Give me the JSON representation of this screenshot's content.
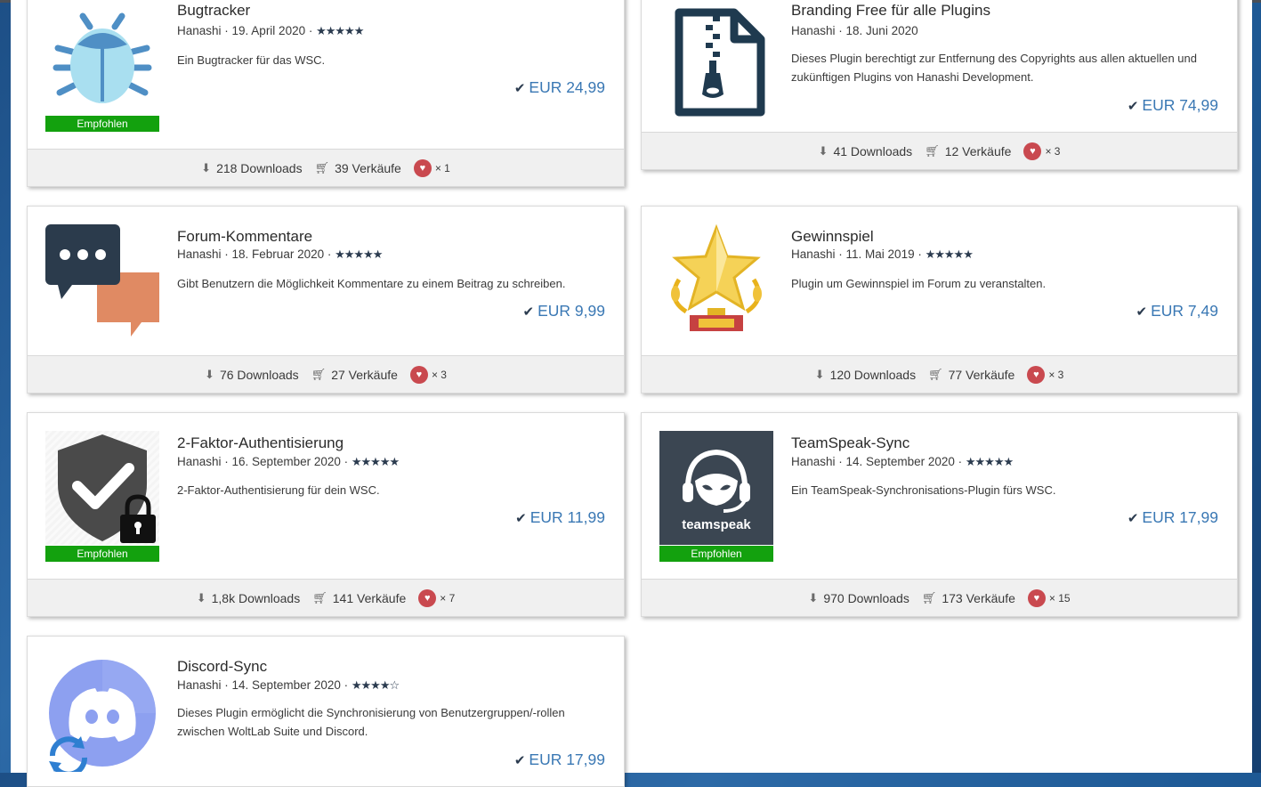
{
  "cards": [
    {
      "title": "Bugtracker",
      "author": "Hanashi",
      "date": "19. April 2020",
      "stars": "★★★★★",
      "description": "Ein Bugtracker für das WSC.",
      "price": "EUR 24,99",
      "badge": "Empfohlen",
      "downloads": "218 Downloads",
      "sales": "39 Verkäufe",
      "likes": "× 1",
      "icon": "bug-icon"
    },
    {
      "title": "Branding Free für alle Plugins",
      "author": "Hanashi",
      "date": "18. Juni 2020",
      "stars": "",
      "description": "Dieses Plugin berechtigt zur Entfernung des Copyrights aus allen aktuellen und zukünftigen Plugins von Hanashi Development.",
      "price": "EUR 74,99",
      "badge": "",
      "downloads": "41 Downloads",
      "sales": "12 Verkäufe",
      "likes": "× 3",
      "icon": "zip-file-icon"
    },
    {
      "title": "Forum-Kommentare",
      "author": "Hanashi",
      "date": "18. Februar 2020",
      "stars": "★★★★★",
      "description": "Gibt Benutzern die Möglichkeit Kommentare zu einem Beitrag zu schreiben.",
      "price": "EUR 9,99",
      "badge": "",
      "downloads": "76 Downloads",
      "sales": "27 Verkäufe",
      "likes": "× 3",
      "icon": "chat-bubbles-icon"
    },
    {
      "title": "Gewinnspiel",
      "author": "Hanashi",
      "date": "11. Mai 2019",
      "stars": "★★★★★",
      "description": "Plugin um Gewinnspiel im Forum zu veranstalten.",
      "price": "EUR 7,49",
      "badge": "",
      "downloads": "120 Downloads",
      "sales": "77 Verkäufe",
      "likes": "× 3",
      "icon": "star-trophy-icon"
    },
    {
      "title": "2-Faktor-Authentisierung",
      "author": "Hanashi",
      "date": "16. September 2020",
      "stars": "★★★★★",
      "description": "2-Faktor-Authentisierung für dein WSC.",
      "price": "EUR 11,99",
      "badge": "Empfohlen",
      "downloads": "1,8k Downloads",
      "sales": "141 Verkäufe",
      "likes": "× 7",
      "icon": "shield-lock-icon"
    },
    {
      "title": "TeamSpeak-Sync",
      "author": "Hanashi",
      "date": "14. September 2020",
      "stars": "★★★★★",
      "description": "Ein TeamSpeak-Synchronisations-Plugin fürs WSC.",
      "price": "EUR 17,99",
      "badge": "Empfohlen",
      "logo_text": "teamspeak",
      "downloads": "970 Downloads",
      "sales": "173 Verkäufe",
      "likes": "× 15",
      "icon": "teamspeak-logo-icon"
    },
    {
      "title": "Discord-Sync",
      "author": "Hanashi",
      "date": "14. September 2020",
      "stars": "★★★★☆",
      "description": "Dieses Plugin ermöglicht die Synchronisierung von Benutzergruppen/-rollen zwischen WoltLab Suite und Discord.",
      "price": "EUR 17,99",
      "badge": "",
      "icon": "discord-sync-icon"
    }
  ],
  "colors": {
    "badge": "#13a10e",
    "price": "#3a78b4",
    "heart": "#c9494f",
    "stars": "#2b3b4f"
  }
}
